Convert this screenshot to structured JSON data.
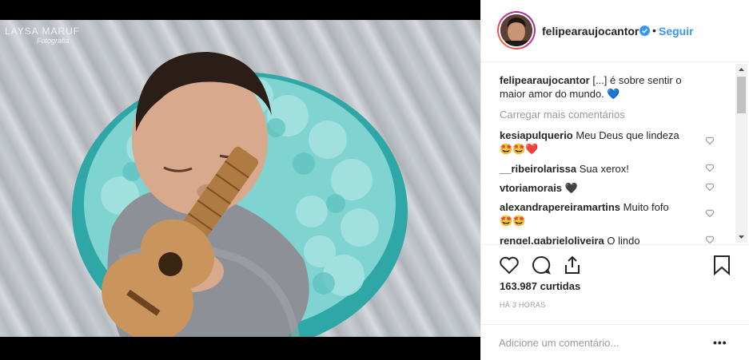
{
  "photo": {
    "watermark_name": "LAYSA MARUF",
    "watermark_sub": "Fotografia"
  },
  "header": {
    "username": "felipearaujocantor",
    "separator": "•",
    "follow_label": "Seguir"
  },
  "caption": {
    "username": "felipearaujocantor",
    "text_line1": "[...] é sobre sentir o",
    "text_line2": "maior amor do mundo. 💙"
  },
  "load_more_label": "Carregar mais comentários",
  "comments": [
    {
      "username": "kesiapulquerio",
      "text": "Meu Deus que lindeza",
      "text2": "🤩🤩❤️"
    },
    {
      "username": "__ribeirolarissa",
      "text": "Sua xerox!",
      "text2": ""
    },
    {
      "username": "vtoriamorais",
      "text": "🖤",
      "text2": ""
    },
    {
      "username": "alexandrapereiramartins",
      "text": "Muito fofo",
      "text2": "🤩🤩"
    },
    {
      "username": "rengel.gabrieloliveira",
      "text": "Q lindo",
      "text2": ""
    }
  ],
  "likes_label": "163.987 curtidas",
  "time_label": "HÁ 3 HORAS",
  "add_comment": {
    "placeholder": "Adicione um comentário...",
    "more_label": "•••"
  },
  "colors": {
    "accent": "#3897f0",
    "text": "#262626",
    "muted": "#999999",
    "blanket": "#7fd4d2"
  },
  "icons": [
    "verified-badge-icon",
    "heart-icon",
    "comment-icon",
    "share-icon",
    "bookmark-icon",
    "more-options-icon"
  ]
}
